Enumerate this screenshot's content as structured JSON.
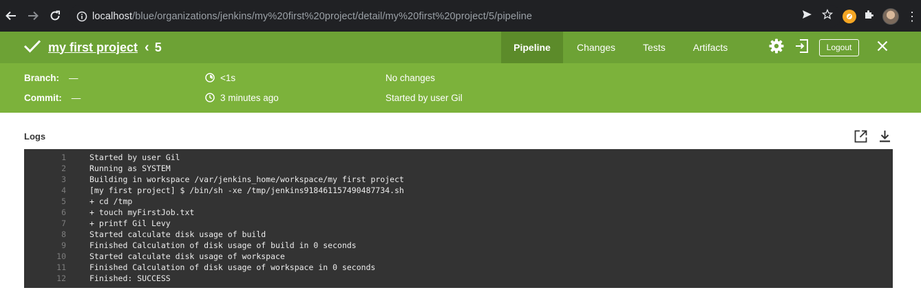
{
  "browser": {
    "url_host": "localhost",
    "url_path": "/blue/organizations/jenkins/my%20first%20project/detail/my%20first%20project/5/pipeline"
  },
  "header": {
    "project_name": "my first project",
    "run_number": "5",
    "tabs": [
      {
        "label": "Pipeline",
        "active": true
      },
      {
        "label": "Changes",
        "active": false
      },
      {
        "label": "Tests",
        "active": false
      },
      {
        "label": "Artifacts",
        "active": false
      }
    ],
    "logout_label": "Logout",
    "accent_color": "#6da235",
    "active_tab_color": "#5c8b2a"
  },
  "summary": {
    "branch_label": "Branch:",
    "branch_value": "—",
    "commit_label": "Commit:",
    "commit_value": "—",
    "duration": "<1s",
    "started_ago": "3 minutes ago",
    "changes": "No changes",
    "started_by": "Started by user Gil",
    "band_color": "#7cb23b"
  },
  "logs": {
    "title": "Logs",
    "lines": [
      {
        "n": "1",
        "text": "Started by user Gil"
      },
      {
        "n": "2",
        "text": "Running as SYSTEM"
      },
      {
        "n": "3",
        "text": "Building in workspace /var/jenkins_home/workspace/my first project"
      },
      {
        "n": "4",
        "text": "[my first project] $ /bin/sh -xe /tmp/jenkins918461157490487734.sh"
      },
      {
        "n": "5",
        "text": "+ cd /tmp"
      },
      {
        "n": "6",
        "text": "+ touch myFirstJob.txt"
      },
      {
        "n": "7",
        "text": "+ printf Gil Levy"
      },
      {
        "n": "8",
        "text": "Started calculate disk usage of build"
      },
      {
        "n": "9",
        "text": "Finished Calculation of disk usage of build in 0 seconds"
      },
      {
        "n": "10",
        "text": "Started calculate disk usage of workspace"
      },
      {
        "n": "11",
        "text": "Finished Calculation of disk usage of workspace in 0 seconds"
      },
      {
        "n": "12",
        "text": "Finished: SUCCESS"
      }
    ]
  }
}
